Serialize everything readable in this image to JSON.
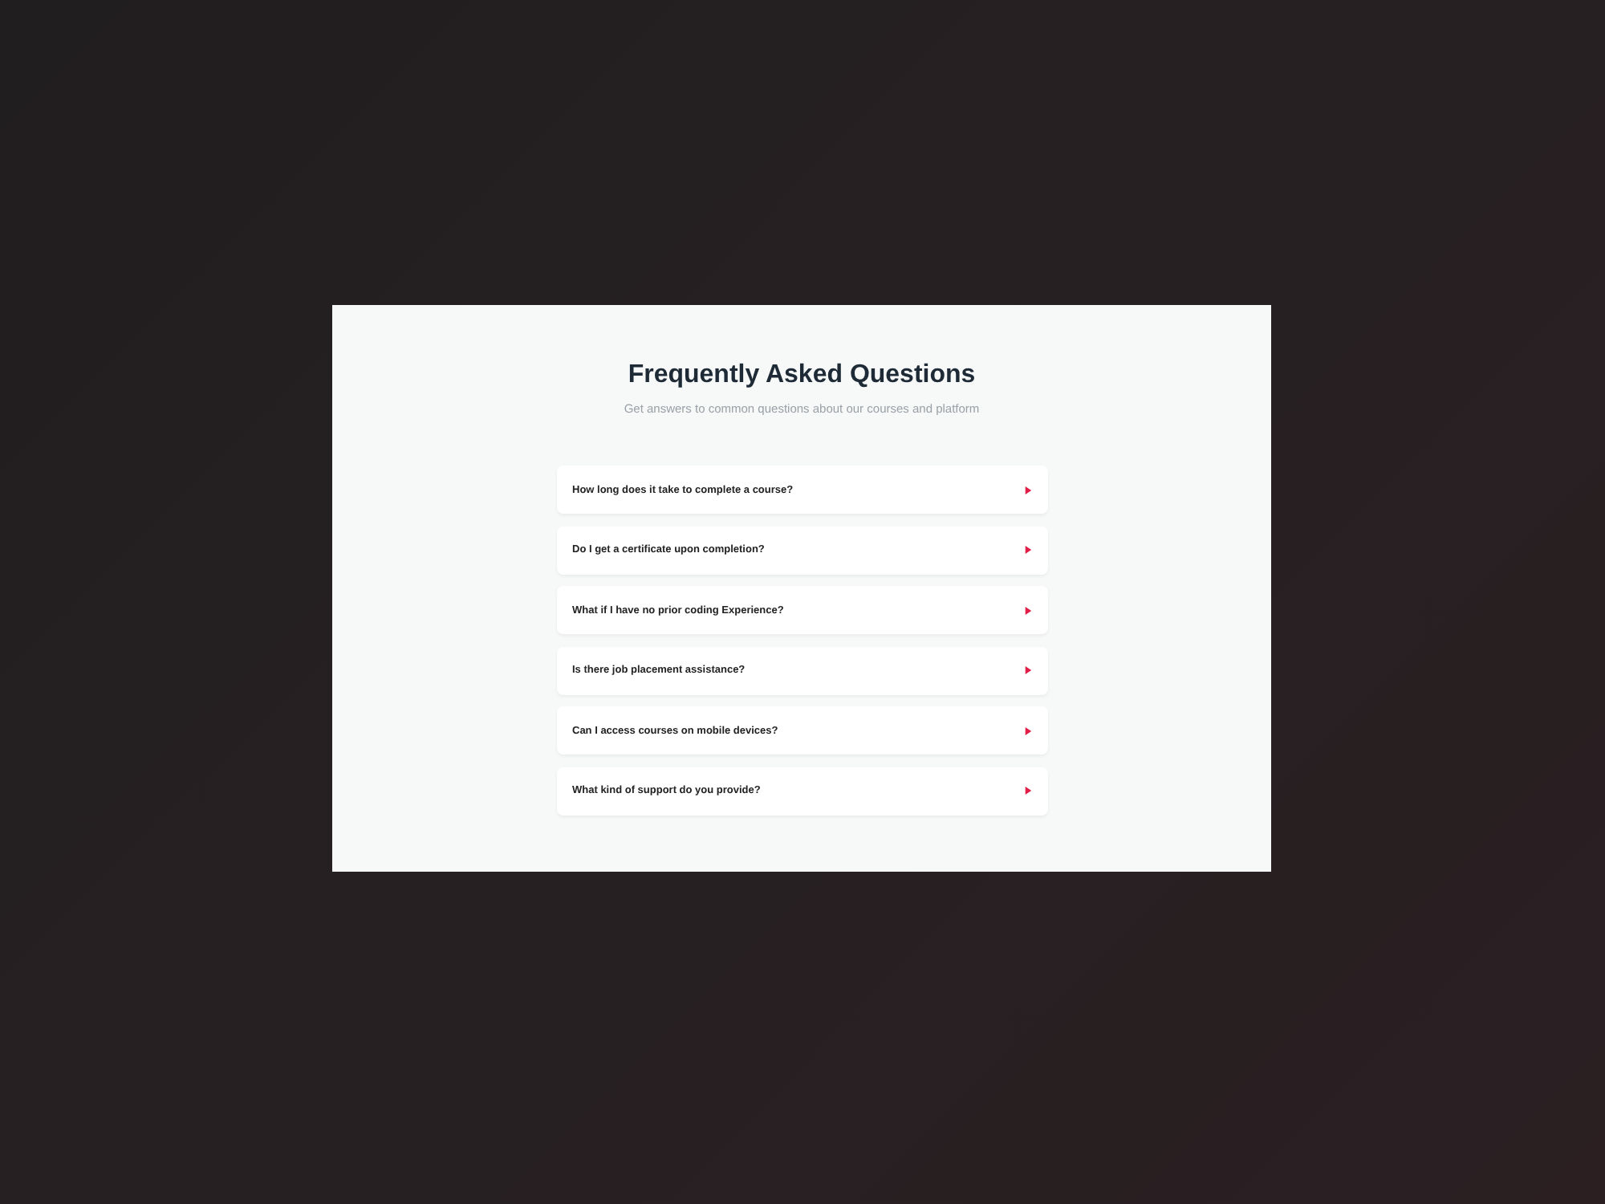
{
  "title": "Frequently Asked Questions",
  "subtitle": "Get answers to common questions about our courses and platform",
  "faqs": [
    {
      "question": "How long does it take to complete a course?",
      "expanded": false
    },
    {
      "question": "Do I get a certificate upon completion?",
      "expanded": false
    },
    {
      "question": "What if I have no prior coding Experience?",
      "expanded": false
    },
    {
      "question": "Is there job placement assistance?",
      "expanded": false
    },
    {
      "question": "Can I access courses on mobile devices?",
      "expanded": false
    },
    {
      "question": "What kind of support do you provide?",
      "expanded": false
    }
  ]
}
